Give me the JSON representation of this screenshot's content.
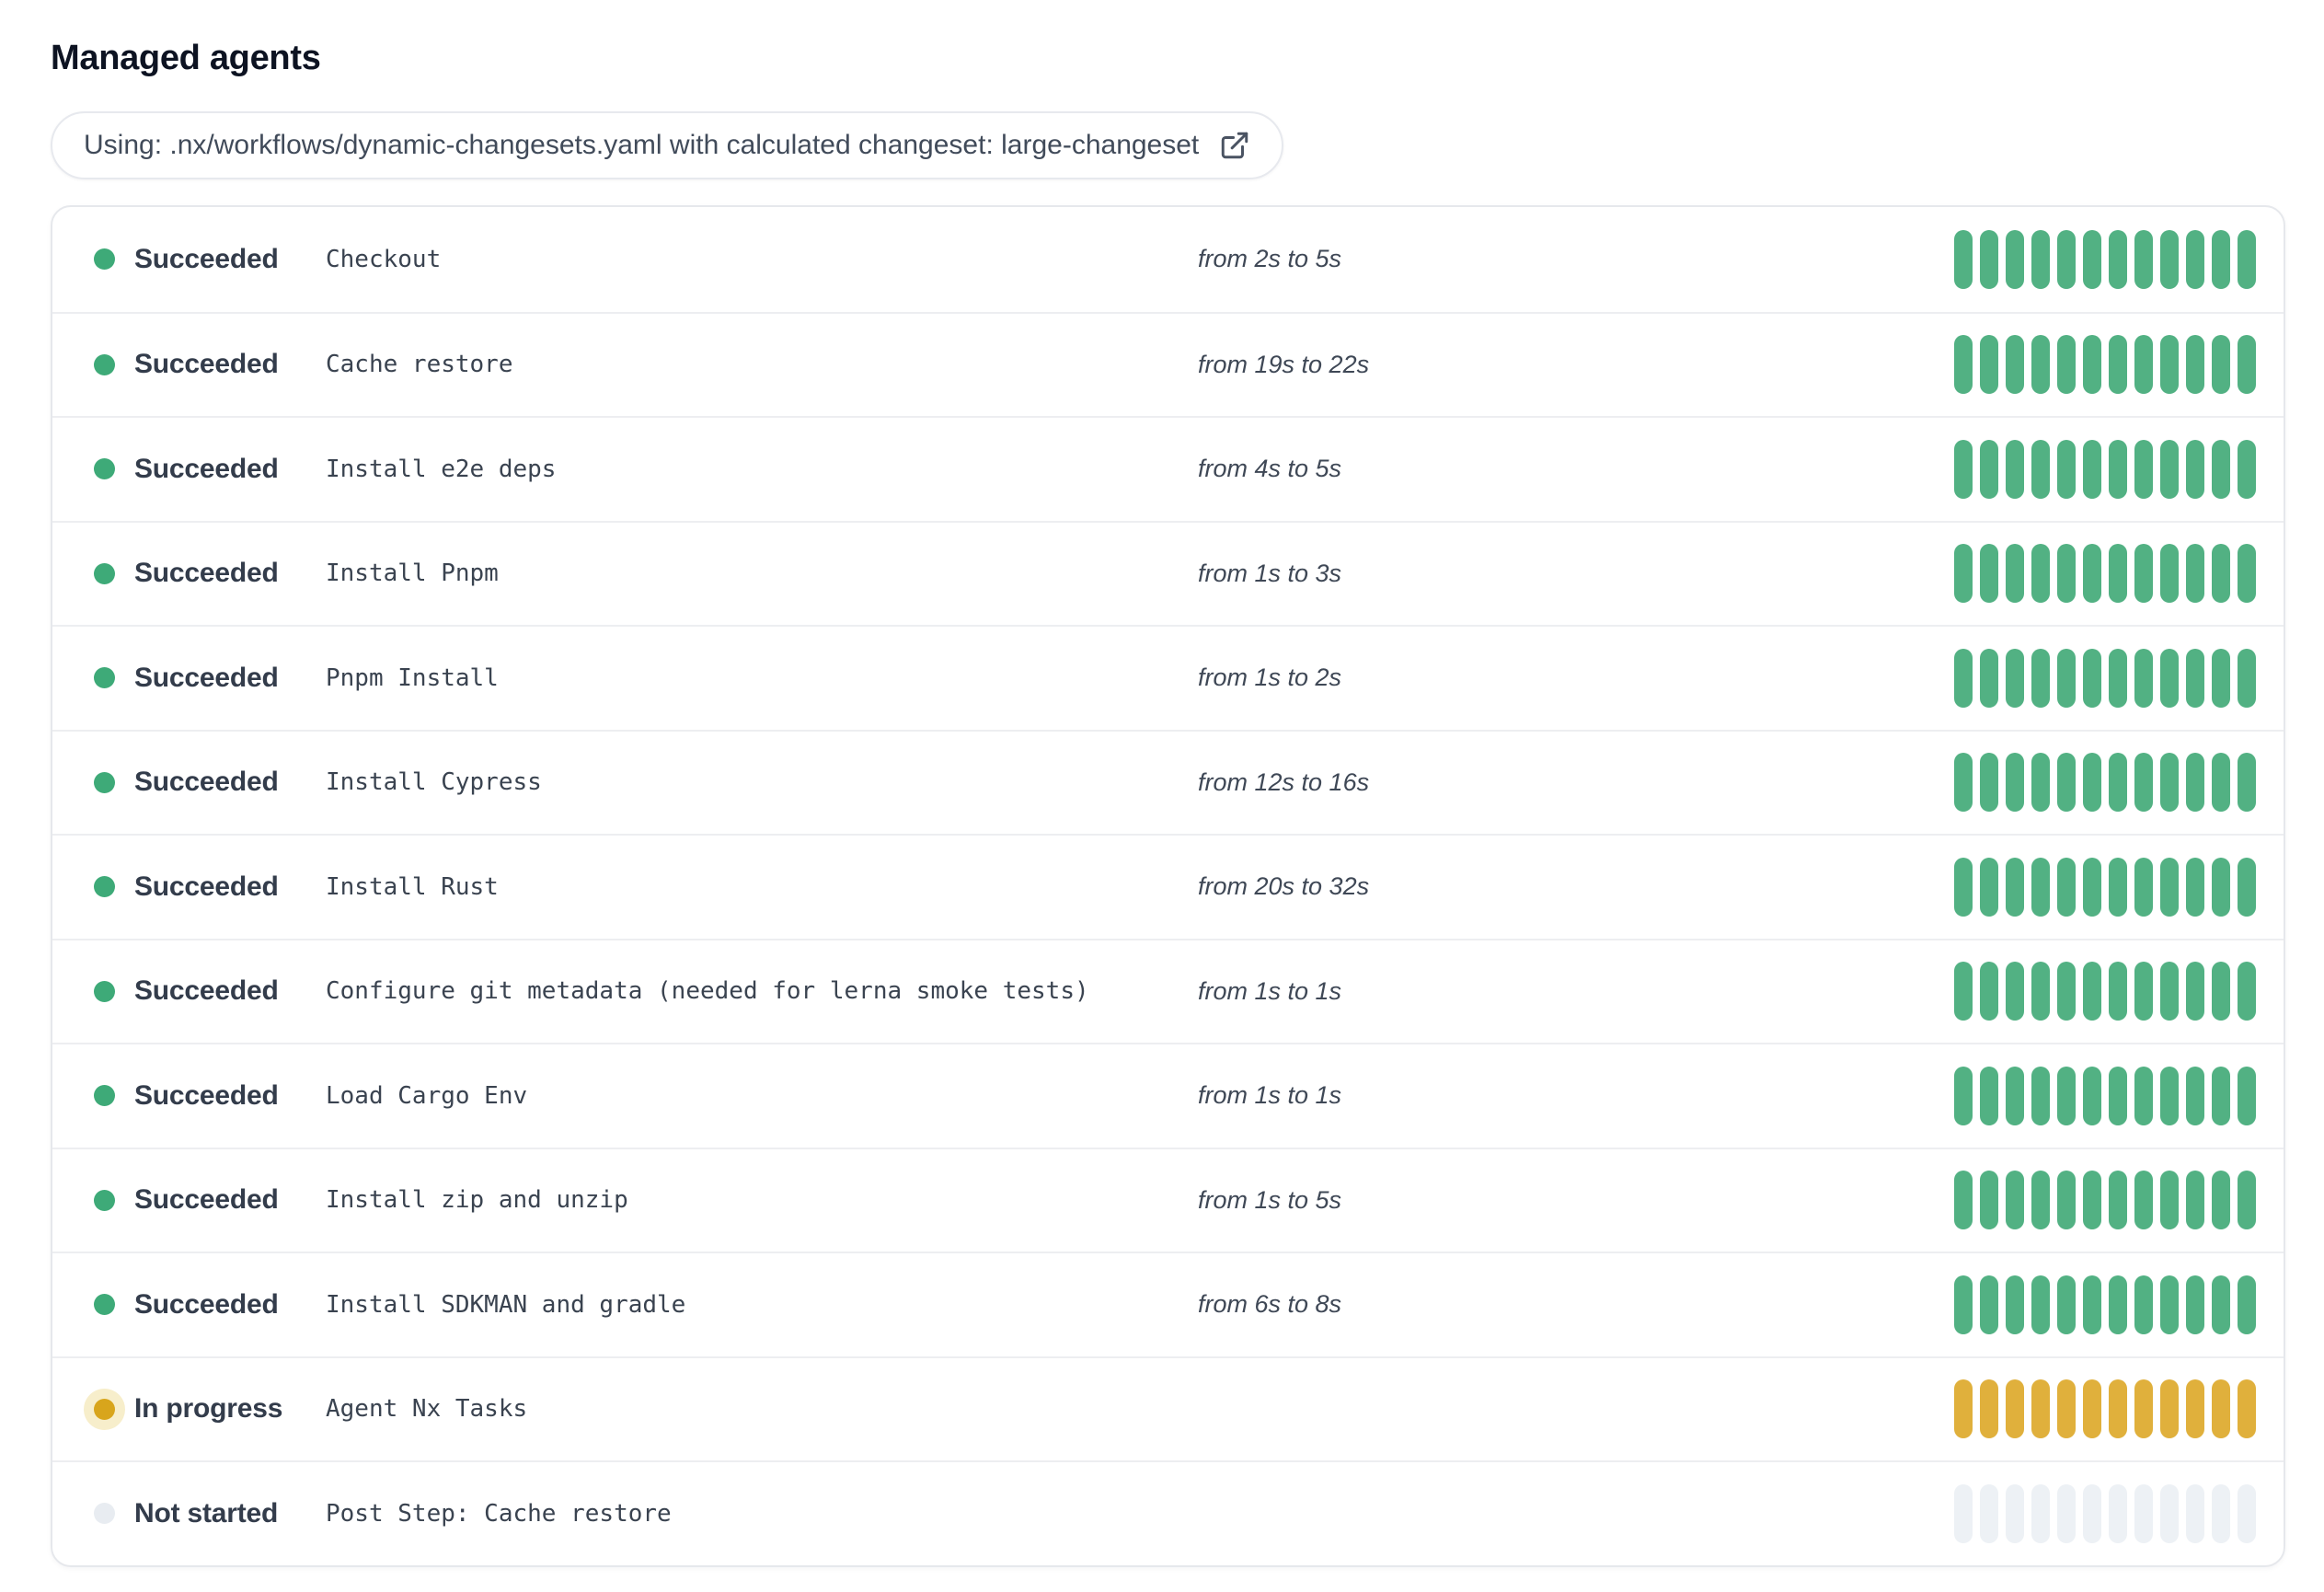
{
  "page_title": "Managed agents",
  "workflow_link": {
    "text": "Using: .nx/workflows/dynamic-changesets.yaml with calculated changeset: large-changeset",
    "icon": "external-link-icon"
  },
  "bar": {
    "segments_per_row": 12
  },
  "colors": {
    "succeeded": {
      "dot": "#3EAA78",
      "segment": "#52B183"
    },
    "in_progress": {
      "dot": "#D8A51C",
      "halo": "#F7EECB",
      "segment": "#E0B03C"
    },
    "not_started": {
      "dot": "#E8ECF1",
      "segment": "#EDF1F5"
    }
  },
  "steps": [
    {
      "status": "succeeded",
      "status_label": "Succeeded",
      "name": "Checkout",
      "duration": "from 2s to 5s"
    },
    {
      "status": "succeeded",
      "status_label": "Succeeded",
      "name": "Cache restore",
      "duration": "from 19s to 22s"
    },
    {
      "status": "succeeded",
      "status_label": "Succeeded",
      "name": "Install e2e deps",
      "duration": "from 4s to 5s"
    },
    {
      "status": "succeeded",
      "status_label": "Succeeded",
      "name": "Install Pnpm",
      "duration": "from 1s to 3s"
    },
    {
      "status": "succeeded",
      "status_label": "Succeeded",
      "name": "Pnpm Install",
      "duration": "from 1s to 2s"
    },
    {
      "status": "succeeded",
      "status_label": "Succeeded",
      "name": "Install Cypress",
      "duration": "from 12s to 16s"
    },
    {
      "status": "succeeded",
      "status_label": "Succeeded",
      "name": "Install Rust",
      "duration": "from 20s to 32s"
    },
    {
      "status": "succeeded",
      "status_label": "Succeeded",
      "name": "Configure git metadata (needed for lerna smoke tests)",
      "duration": "from 1s to 1s"
    },
    {
      "status": "succeeded",
      "status_label": "Succeeded",
      "name": "Load Cargo Env",
      "duration": "from 1s to 1s"
    },
    {
      "status": "succeeded",
      "status_label": "Succeeded",
      "name": "Install zip and unzip",
      "duration": "from 1s to 5s"
    },
    {
      "status": "succeeded",
      "status_label": "Succeeded",
      "name": "Install SDKMAN and gradle",
      "duration": "from 6s to 8s"
    },
    {
      "status": "in_progress",
      "status_label": "In progress",
      "name": "Agent Nx Tasks",
      "duration": ""
    },
    {
      "status": "not_started",
      "status_label": "Not started",
      "name": "Post Step: Cache restore",
      "duration": ""
    }
  ]
}
